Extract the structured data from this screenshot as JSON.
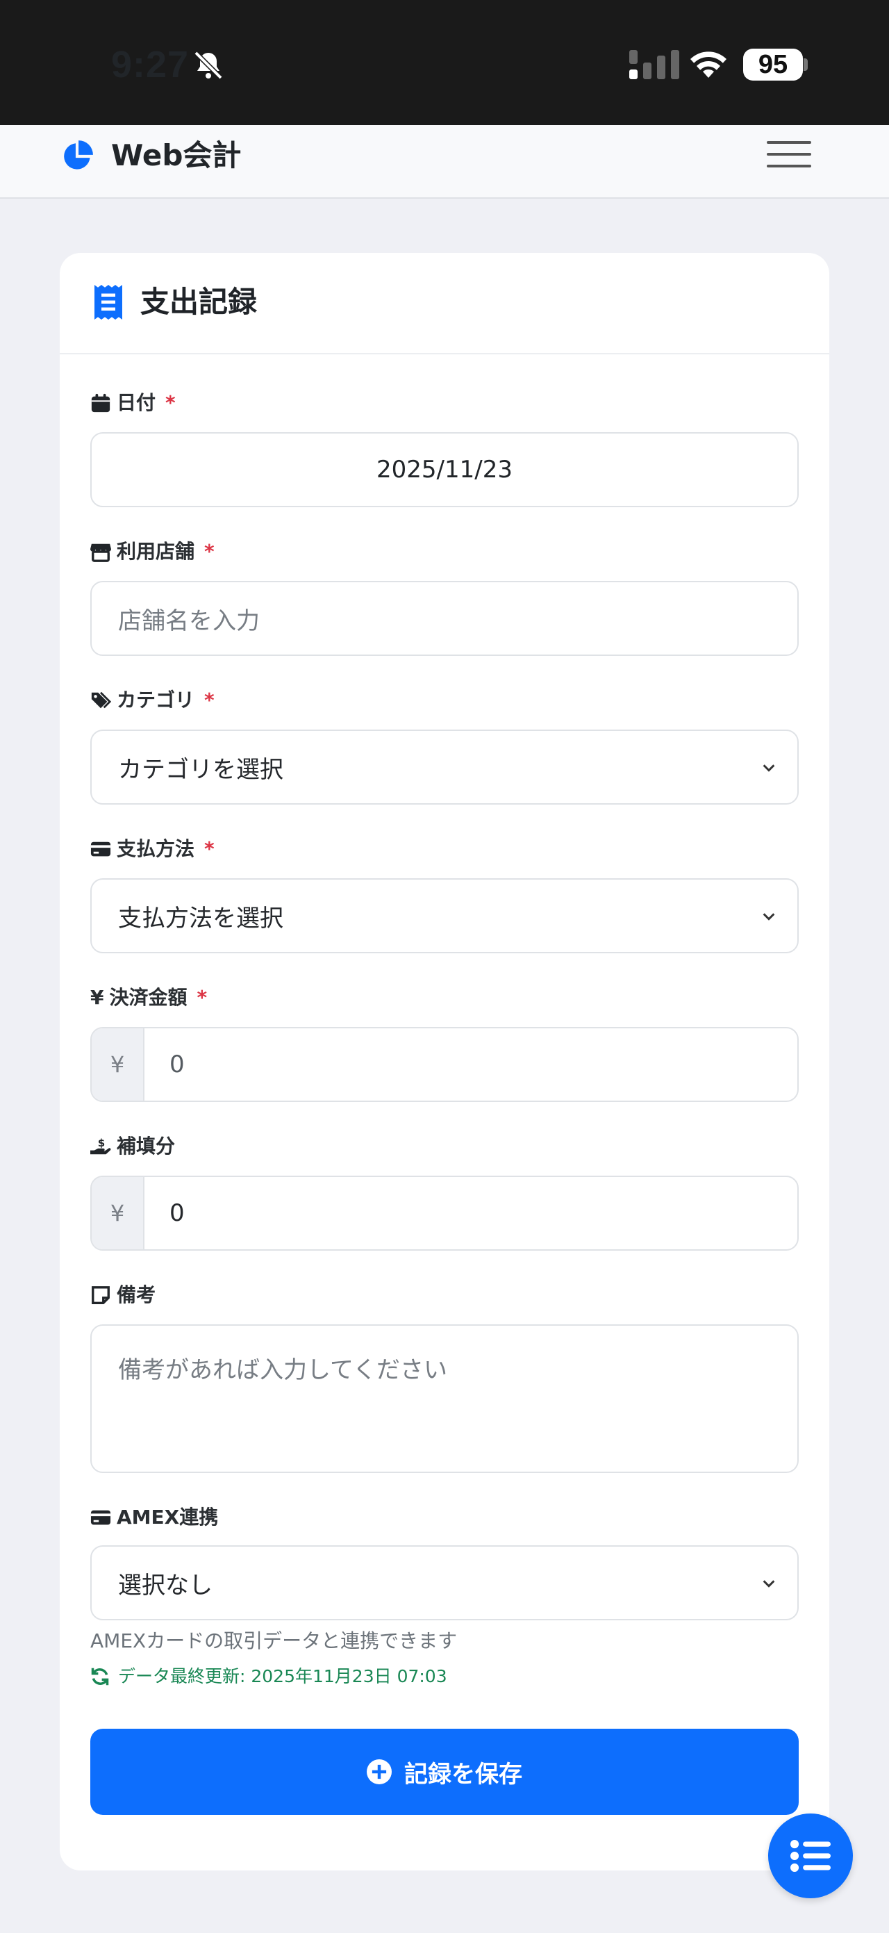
{
  "status_bar": {
    "time": "9:27",
    "battery": "95"
  },
  "navbar": {
    "brand": "Web会計",
    "brand_icon": "pie-chart-icon",
    "menu_icon": "hamburger-icon"
  },
  "card": {
    "title": "支出記録",
    "title_icon": "receipt-icon"
  },
  "form": {
    "date": {
      "label": "日付",
      "required": "*",
      "value": "2025/11/23",
      "icon": "calendar-icon"
    },
    "store": {
      "label": "利用店舗",
      "required": "*",
      "placeholder": "店舗名を入力",
      "icon": "store-icon"
    },
    "category": {
      "label": "カテゴリ",
      "required": "*",
      "selected": "カテゴリを選択",
      "icon": "tags-icon"
    },
    "payment": {
      "label": "支払方法",
      "required": "*",
      "selected": "支払方法を選択",
      "icon": "credit-card-icon"
    },
    "amount": {
      "label": "決済金額",
      "required": "*",
      "prefix": "¥",
      "value": "0",
      "icon": "yen-icon"
    },
    "reimbursement": {
      "label": "補填分",
      "prefix": "¥",
      "value": "0",
      "icon": "hand-holding-dollar-icon"
    },
    "notes": {
      "label": "備考",
      "placeholder": "備考があれば入力してください",
      "icon": "sticky-note-icon"
    },
    "amex": {
      "label": "AMEX連携",
      "selected": "選択なし",
      "help": "AMEXカードの取引データと連携できます",
      "updated": "データ最終更新: 2025年11月23日 07:03",
      "icon": "credit-card-icon"
    }
  },
  "actions": {
    "save_label": "記録を保存",
    "save_icon": "plus-circle-icon",
    "fab_icon": "list-icon"
  },
  "colors": {
    "primary": "#0d6efd",
    "required": "#dc3545",
    "success": "#198754",
    "background": "#eff0f5"
  }
}
